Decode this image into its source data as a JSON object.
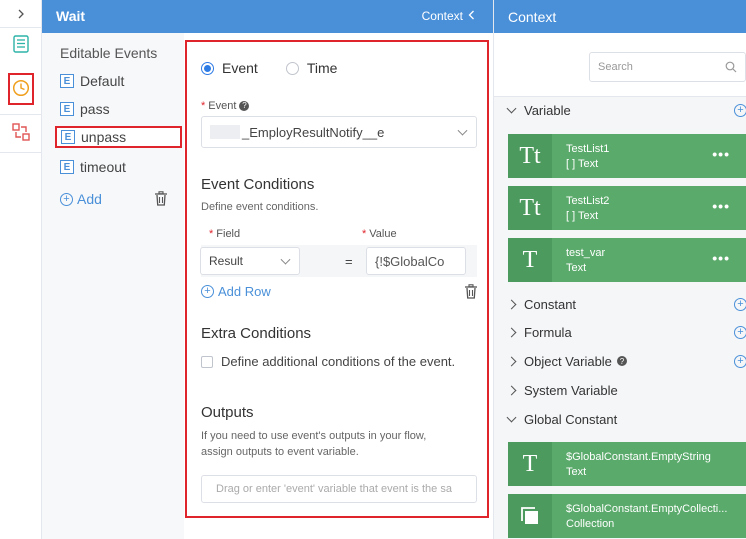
{
  "wait": {
    "title": "Wait",
    "context_label": "Context"
  },
  "events": {
    "title": "Editable Events",
    "badge": "E",
    "items": [
      {
        "label": "Default"
      },
      {
        "label": "pass"
      },
      {
        "label": "unpass"
      },
      {
        "label": "timeout"
      }
    ],
    "add_label": "Add"
  },
  "form": {
    "mode_options": [
      "Event",
      "Time"
    ],
    "selected_mode": "Event",
    "event_label": "Event",
    "event_value": "_EmployResultNotify__e",
    "conditions_title": "Event Conditions",
    "conditions_desc": "Define event conditions.",
    "field_label": "Field",
    "value_label": "Value",
    "field_value": "Result",
    "operator": "=",
    "value_value": "{!$GlobalCo",
    "add_row_label": "Add Row",
    "extra_title": "Extra Conditions",
    "extra_check_label": "Define additional conditions of the event.",
    "outputs_title": "Outputs",
    "outputs_desc_1": "If you need to use event's outputs in your flow,",
    "outputs_desc_2": "assign outputs to event variable.",
    "outputs_placeholder": "Drag or enter 'event' variable that event is the sa"
  },
  "context": {
    "title": "Context",
    "search_placeholder": "Search",
    "variable_group": "Variable",
    "variables": [
      {
        "name": "TestList1",
        "type": "[ ] Text",
        "icon": "Tt"
      },
      {
        "name": "TestList2",
        "type": "[ ] Text",
        "icon": "Tt"
      },
      {
        "name": "test_var",
        "type": "Text",
        "icon": "T"
      }
    ],
    "groups": {
      "constant": "Constant",
      "formula": "Formula",
      "object_variable": "Object Variable",
      "system_variable": "System Variable",
      "global_constant": "Global Constant"
    },
    "global_constants": [
      {
        "name": "$GlobalConstant.EmptyString",
        "type": "Text",
        "icon": "T"
      },
      {
        "name": "$GlobalConstant.EmptyCollecti...",
        "type": "Collection",
        "icon": "collection-icon"
      }
    ],
    "more": "•••"
  },
  "colors": {
    "header_blue": "#4a90d9",
    "card_green": "#5aaa6b",
    "highlight_red": "#e0242c",
    "radio_blue": "#2d7be5"
  }
}
